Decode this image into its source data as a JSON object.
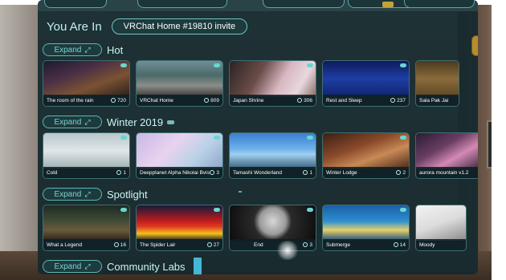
{
  "you_are_in": {
    "label": "You Are In",
    "current_world": "VRChat Home #19810 invite"
  },
  "expand_label": "Expand",
  "rows": [
    {
      "title": "Hot",
      "worlds": [
        {
          "name": "The room of the rain",
          "count": "720"
        },
        {
          "name": "VRChat Home",
          "count": "809"
        },
        {
          "name": "Japan Shrine",
          "count": "306"
        },
        {
          "name": "Rest and Sleep",
          "count": "237"
        },
        {
          "name": "Sala Pak Jai",
          "count": ""
        }
      ]
    },
    {
      "title": "Winter 2019",
      "worlds": [
        {
          "name": "Cold",
          "count": "1"
        },
        {
          "name": "Deepplanet Alpha Nikolai Bvisters",
          "count": "3"
        },
        {
          "name": "Tamashi Wonderland",
          "count": "1"
        },
        {
          "name": "Winter Lodge",
          "count": "2"
        },
        {
          "name": "aurora mountain v1.2",
          "count": ""
        }
      ]
    },
    {
      "title": "Spotlight",
      "worlds": [
        {
          "name": "What a Legend",
          "count": "16"
        },
        {
          "name": "The Spider Lair",
          "count": "27"
        },
        {
          "name": "End",
          "count": "3"
        },
        {
          "name": "Submerge",
          "count": "14"
        },
        {
          "name": "Moody",
          "count": ""
        }
      ]
    }
  ],
  "community_labs": {
    "title": "Community Labs"
  },
  "colors": {
    "accent": "#5eb7b4",
    "panel_bg": "#162a2e",
    "labs_bar": "#42b8d8"
  }
}
